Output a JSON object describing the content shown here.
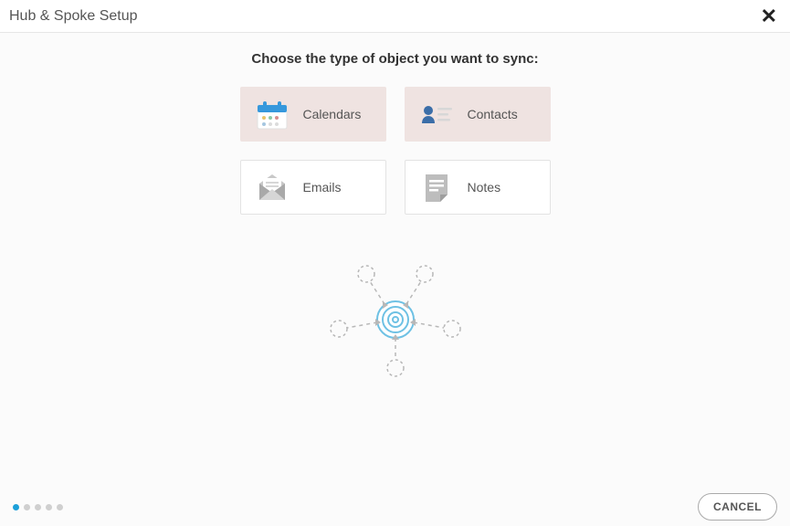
{
  "header": {
    "title": "Hub & Spoke Setup"
  },
  "instruction": "Choose the type of object you want to sync:",
  "options": [
    {
      "id": "calendars",
      "label": "Calendars",
      "selected": true
    },
    {
      "id": "contacts",
      "label": "Contacts",
      "selected": true
    },
    {
      "id": "emails",
      "label": "Emails",
      "selected": false
    },
    {
      "id": "notes",
      "label": "Notes",
      "selected": false
    }
  ],
  "progress": {
    "steps": 5,
    "current": 1
  },
  "footer": {
    "cancel_label": "CANCEL"
  }
}
